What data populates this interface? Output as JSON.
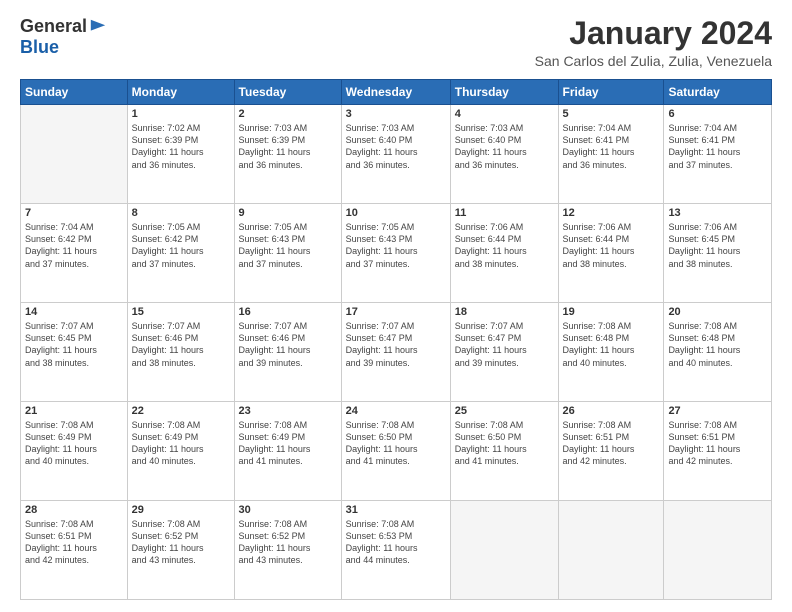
{
  "logo": {
    "general": "General",
    "blue": "Blue"
  },
  "header": {
    "title": "January 2024",
    "subtitle": "San Carlos del Zulia, Zulia, Venezuela"
  },
  "weekdays": [
    "Sunday",
    "Monday",
    "Tuesday",
    "Wednesday",
    "Thursday",
    "Friday",
    "Saturday"
  ],
  "weeks": [
    [
      {
        "day": "",
        "text": ""
      },
      {
        "day": "1",
        "text": "Sunrise: 7:02 AM\nSunset: 6:39 PM\nDaylight: 11 hours\nand 36 minutes."
      },
      {
        "day": "2",
        "text": "Sunrise: 7:03 AM\nSunset: 6:39 PM\nDaylight: 11 hours\nand 36 minutes."
      },
      {
        "day": "3",
        "text": "Sunrise: 7:03 AM\nSunset: 6:40 PM\nDaylight: 11 hours\nand 36 minutes."
      },
      {
        "day": "4",
        "text": "Sunrise: 7:03 AM\nSunset: 6:40 PM\nDaylight: 11 hours\nand 36 minutes."
      },
      {
        "day": "5",
        "text": "Sunrise: 7:04 AM\nSunset: 6:41 PM\nDaylight: 11 hours\nand 36 minutes."
      },
      {
        "day": "6",
        "text": "Sunrise: 7:04 AM\nSunset: 6:41 PM\nDaylight: 11 hours\nand 37 minutes."
      }
    ],
    [
      {
        "day": "7",
        "text": "Sunrise: 7:04 AM\nSunset: 6:42 PM\nDaylight: 11 hours\nand 37 minutes."
      },
      {
        "day": "8",
        "text": "Sunrise: 7:05 AM\nSunset: 6:42 PM\nDaylight: 11 hours\nand 37 minutes."
      },
      {
        "day": "9",
        "text": "Sunrise: 7:05 AM\nSunset: 6:43 PM\nDaylight: 11 hours\nand 37 minutes."
      },
      {
        "day": "10",
        "text": "Sunrise: 7:05 AM\nSunset: 6:43 PM\nDaylight: 11 hours\nand 37 minutes."
      },
      {
        "day": "11",
        "text": "Sunrise: 7:06 AM\nSunset: 6:44 PM\nDaylight: 11 hours\nand 38 minutes."
      },
      {
        "day": "12",
        "text": "Sunrise: 7:06 AM\nSunset: 6:44 PM\nDaylight: 11 hours\nand 38 minutes."
      },
      {
        "day": "13",
        "text": "Sunrise: 7:06 AM\nSunset: 6:45 PM\nDaylight: 11 hours\nand 38 minutes."
      }
    ],
    [
      {
        "day": "14",
        "text": "Sunrise: 7:07 AM\nSunset: 6:45 PM\nDaylight: 11 hours\nand 38 minutes."
      },
      {
        "day": "15",
        "text": "Sunrise: 7:07 AM\nSunset: 6:46 PM\nDaylight: 11 hours\nand 38 minutes."
      },
      {
        "day": "16",
        "text": "Sunrise: 7:07 AM\nSunset: 6:46 PM\nDaylight: 11 hours\nand 39 minutes."
      },
      {
        "day": "17",
        "text": "Sunrise: 7:07 AM\nSunset: 6:47 PM\nDaylight: 11 hours\nand 39 minutes."
      },
      {
        "day": "18",
        "text": "Sunrise: 7:07 AM\nSunset: 6:47 PM\nDaylight: 11 hours\nand 39 minutes."
      },
      {
        "day": "19",
        "text": "Sunrise: 7:08 AM\nSunset: 6:48 PM\nDaylight: 11 hours\nand 40 minutes."
      },
      {
        "day": "20",
        "text": "Sunrise: 7:08 AM\nSunset: 6:48 PM\nDaylight: 11 hours\nand 40 minutes."
      }
    ],
    [
      {
        "day": "21",
        "text": "Sunrise: 7:08 AM\nSunset: 6:49 PM\nDaylight: 11 hours\nand 40 minutes."
      },
      {
        "day": "22",
        "text": "Sunrise: 7:08 AM\nSunset: 6:49 PM\nDaylight: 11 hours\nand 40 minutes."
      },
      {
        "day": "23",
        "text": "Sunrise: 7:08 AM\nSunset: 6:49 PM\nDaylight: 11 hours\nand 41 minutes."
      },
      {
        "day": "24",
        "text": "Sunrise: 7:08 AM\nSunset: 6:50 PM\nDaylight: 11 hours\nand 41 minutes."
      },
      {
        "day": "25",
        "text": "Sunrise: 7:08 AM\nSunset: 6:50 PM\nDaylight: 11 hours\nand 41 minutes."
      },
      {
        "day": "26",
        "text": "Sunrise: 7:08 AM\nSunset: 6:51 PM\nDaylight: 11 hours\nand 42 minutes."
      },
      {
        "day": "27",
        "text": "Sunrise: 7:08 AM\nSunset: 6:51 PM\nDaylight: 11 hours\nand 42 minutes."
      }
    ],
    [
      {
        "day": "28",
        "text": "Sunrise: 7:08 AM\nSunset: 6:51 PM\nDaylight: 11 hours\nand 42 minutes."
      },
      {
        "day": "29",
        "text": "Sunrise: 7:08 AM\nSunset: 6:52 PM\nDaylight: 11 hours\nand 43 minutes."
      },
      {
        "day": "30",
        "text": "Sunrise: 7:08 AM\nSunset: 6:52 PM\nDaylight: 11 hours\nand 43 minutes."
      },
      {
        "day": "31",
        "text": "Sunrise: 7:08 AM\nSunset: 6:53 PM\nDaylight: 11 hours\nand 44 minutes."
      },
      {
        "day": "",
        "text": ""
      },
      {
        "day": "",
        "text": ""
      },
      {
        "day": "",
        "text": ""
      }
    ]
  ]
}
